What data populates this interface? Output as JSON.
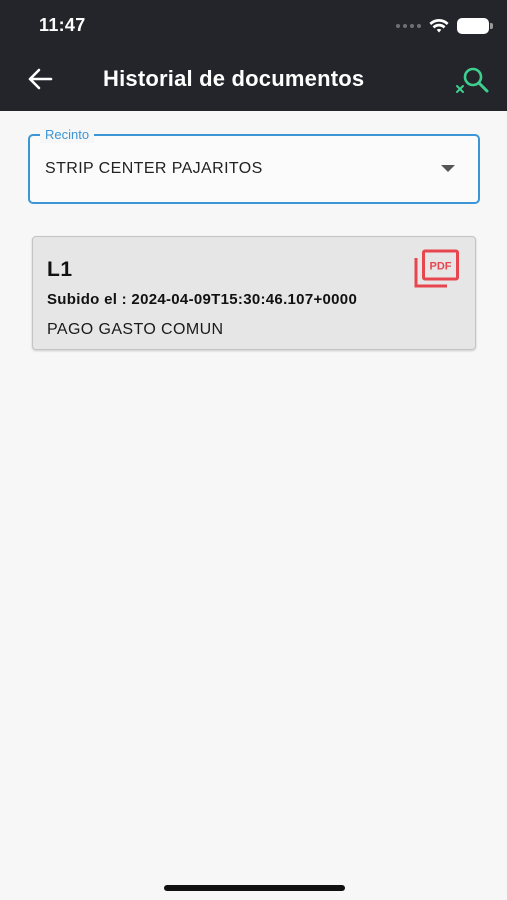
{
  "status_bar": {
    "time": "11:47"
  },
  "app_bar": {
    "title": "Historial de documentos",
    "back_icon": "arrow-left-icon",
    "search_icon": "search-clear-icon",
    "accent_color": "#3ecf8e"
  },
  "filter": {
    "label": "Recinto",
    "value": "STRIP CENTER PAJARITOS",
    "accent_color": "#3c96d6"
  },
  "documents": [
    {
      "title": "L1",
      "uploaded": "Subido el : 2024-04-09T15:30:46.107+0000",
      "description": "PAGO GASTO COMUN",
      "icon": "pdf-file-icon",
      "icon_label": "PDF",
      "icon_color": "#e8464e"
    }
  ]
}
